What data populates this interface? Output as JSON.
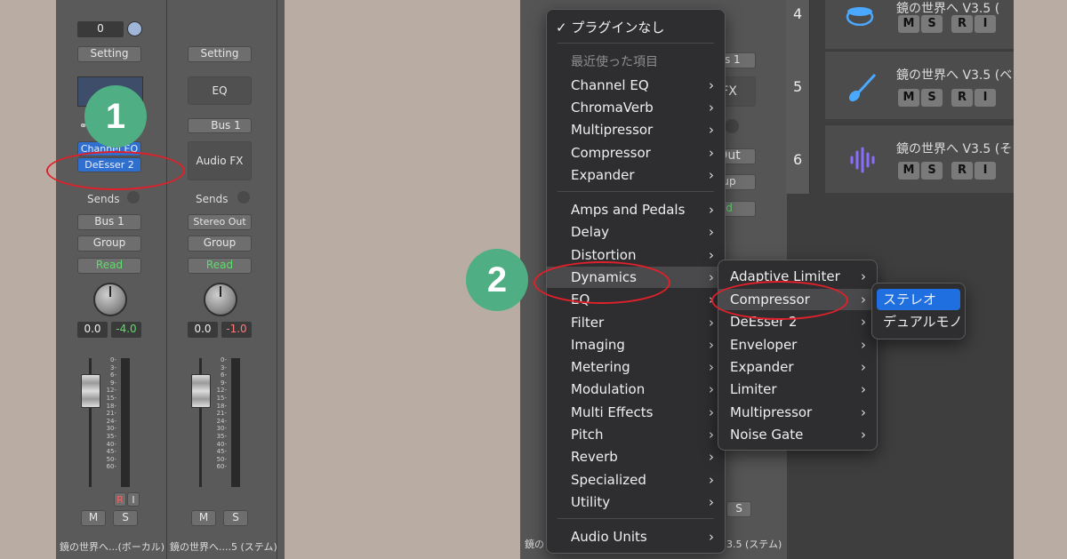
{
  "left_mixer": {
    "strip1": {
      "value_top": "0",
      "setting": "Setting",
      "bus_label": "Bus 1",
      "plugins": [
        "Channel EQ",
        "DeEsser 2"
      ],
      "sends": "Sends",
      "output": "Bus 1",
      "group": "Group",
      "automation": "Read",
      "pan_val": "0.0",
      "level_val": "-4.0",
      "r_btn": "R",
      "i_btn": "I",
      "m_btn": "M",
      "s_btn": "S",
      "name": "鏡の世界へ...(ボーカル)"
    },
    "strip2": {
      "setting": "Setting",
      "eq": "EQ",
      "bus": "Bus 1",
      "audio_fx": "Audio FX",
      "sends": "Sends",
      "output": "Stereo Out",
      "group": "Group",
      "automation": "Read",
      "pan_val": "0.0",
      "level_val": "-1.0",
      "m_btn": "M",
      "s_btn": "S",
      "name": "鏡の世界へ....5 (ステム)"
    },
    "scale": [
      "0-",
      "3-",
      "6-",
      "9-",
      "12-",
      "15-",
      "18-",
      "21-",
      "24-",
      "30-",
      "35-",
      "40-",
      "45-",
      "50-",
      "60-"
    ]
  },
  "step_badges": {
    "one": "1",
    "two": "2"
  },
  "main_menu": {
    "checked_item": "✓ プラグインなし",
    "recent_header": "最近使った項目",
    "recent": [
      "Channel EQ",
      "ChromaVerb",
      "Multipressor",
      "Compressor",
      "Expander"
    ],
    "categories": [
      "Amps and Pedals",
      "Delay",
      "Distortion",
      "Dynamics",
      "EQ",
      "Filter",
      "Imaging",
      "Metering",
      "Modulation",
      "Multi Effects",
      "Pitch",
      "Reverb",
      "Specialized",
      "Utility"
    ],
    "audio_units": "Audio Units",
    "highlighted": "Dynamics"
  },
  "dynamics_menu": {
    "items": [
      "Adaptive Limiter",
      "Compressor",
      "DeEsser 2",
      "Enveloper",
      "Expander",
      "Limiter",
      "Multipressor",
      "Noise Gate"
    ],
    "highlighted": "Compressor"
  },
  "compressor_menu": {
    "items": [
      "ステレオ",
      "デュアルモノ"
    ],
    "selected": "ステレオ"
  },
  "right_bg": {
    "bus_partial": "us 1",
    "fx_partial": "FX",
    "out_partial": "Out",
    "group_partial": "up",
    "read_partial": "d",
    "s_btn": "S",
    "name_partial_left": "鏡の",
    "name_partial_right": "3.5 (ステム)"
  },
  "tracks": [
    {
      "num": "4",
      "name": "鏡の世界へ V3.5 (",
      "icon": "drums-icon"
    },
    {
      "num": "5",
      "name": "鏡の世界へ V3.5 (ベ",
      "icon": "bass-guitar-icon"
    },
    {
      "num": "6",
      "name": "鏡の世界へ V3.5 (そ",
      "icon": "waveform-icon"
    }
  ],
  "track_buttons": [
    "M",
    "S",
    "R",
    "I"
  ],
  "colors": {
    "background": "#b9ada3",
    "badge": "#4fae83",
    "annotation_red": "#e0202a",
    "selection_blue": "#1f6fe0"
  }
}
